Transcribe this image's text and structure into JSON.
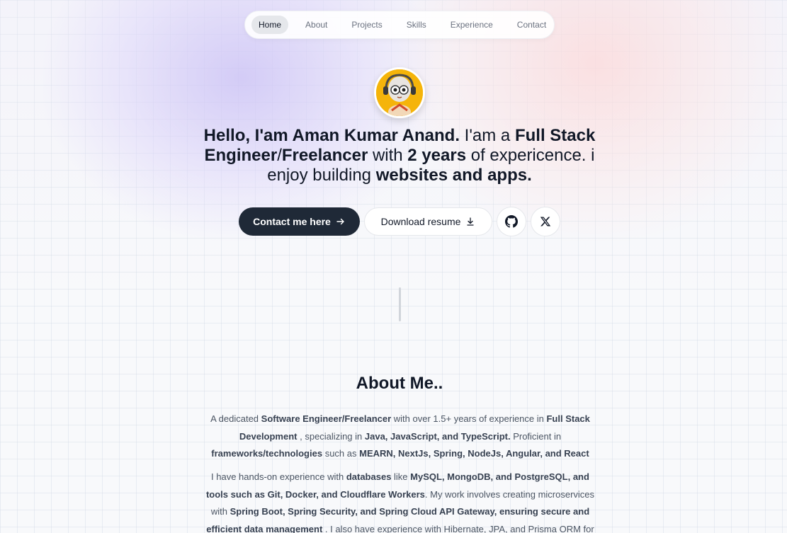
{
  "nav": {
    "items": [
      {
        "label": "Home",
        "active": true
      },
      {
        "label": "About"
      },
      {
        "label": "Projects"
      },
      {
        "label": "Skills"
      },
      {
        "label": "Experience"
      },
      {
        "label": "Contact"
      }
    ]
  },
  "hero": {
    "avatar_icon": "avatar-headphones-character",
    "segments": [
      {
        "b": "Hello, I'am Aman Kumar Anand."
      },
      {
        "t": " I'am a "
      },
      {
        "b": "Full Stack Engineer"
      },
      {
        "t": "/"
      },
      {
        "b": "Freelancer"
      },
      {
        "t": " with "
      },
      {
        "b": "2 years"
      },
      {
        "t": " of expericence. i enjoy building "
      },
      {
        "b": "websites and apps."
      }
    ]
  },
  "buttons": {
    "contact_label": "Contact me here",
    "resume_label": "Download resume",
    "github_icon": "github-icon",
    "x_icon": "x-icon"
  },
  "about": {
    "title": "About Me..",
    "p1": [
      {
        "t": "A dedicated "
      },
      {
        "b": "Software Engineer/Freelancer"
      },
      {
        "t": " with over 1.5+ years of experience in "
      },
      {
        "b": "Full Stack Development"
      },
      {
        "t": " , specializing in "
      },
      {
        "b": "Java, JavaScript, and TypeScript."
      },
      {
        "t": " Proficient in "
      },
      {
        "b": "frameworks/technologies"
      },
      {
        "t": " such as "
      },
      {
        "b": "MEARN, NextJs, Spring, NodeJs, Angular, and React"
      }
    ],
    "p2": [
      {
        "t": "I have hands-on experience with "
      },
      {
        "b": "databases"
      },
      {
        "t": " like "
      },
      {
        "b": "MySQL, MongoDB, and PostgreSQL, and tools such as Git, Docker, and Cloudflare Workers"
      },
      {
        "t": ". My work involves creating microservices with "
      },
      {
        "b": "Spring Boot, Spring Security, and Spring Cloud API Gateway, ensuring secure and efficient data management"
      },
      {
        "t": " . I also have experience with Hibernate, JPA, and Prisma ORM for database"
      }
    ]
  },
  "colors": {
    "primary_button": "#1f2937",
    "text": "#111827",
    "muted": "#4b5563"
  }
}
